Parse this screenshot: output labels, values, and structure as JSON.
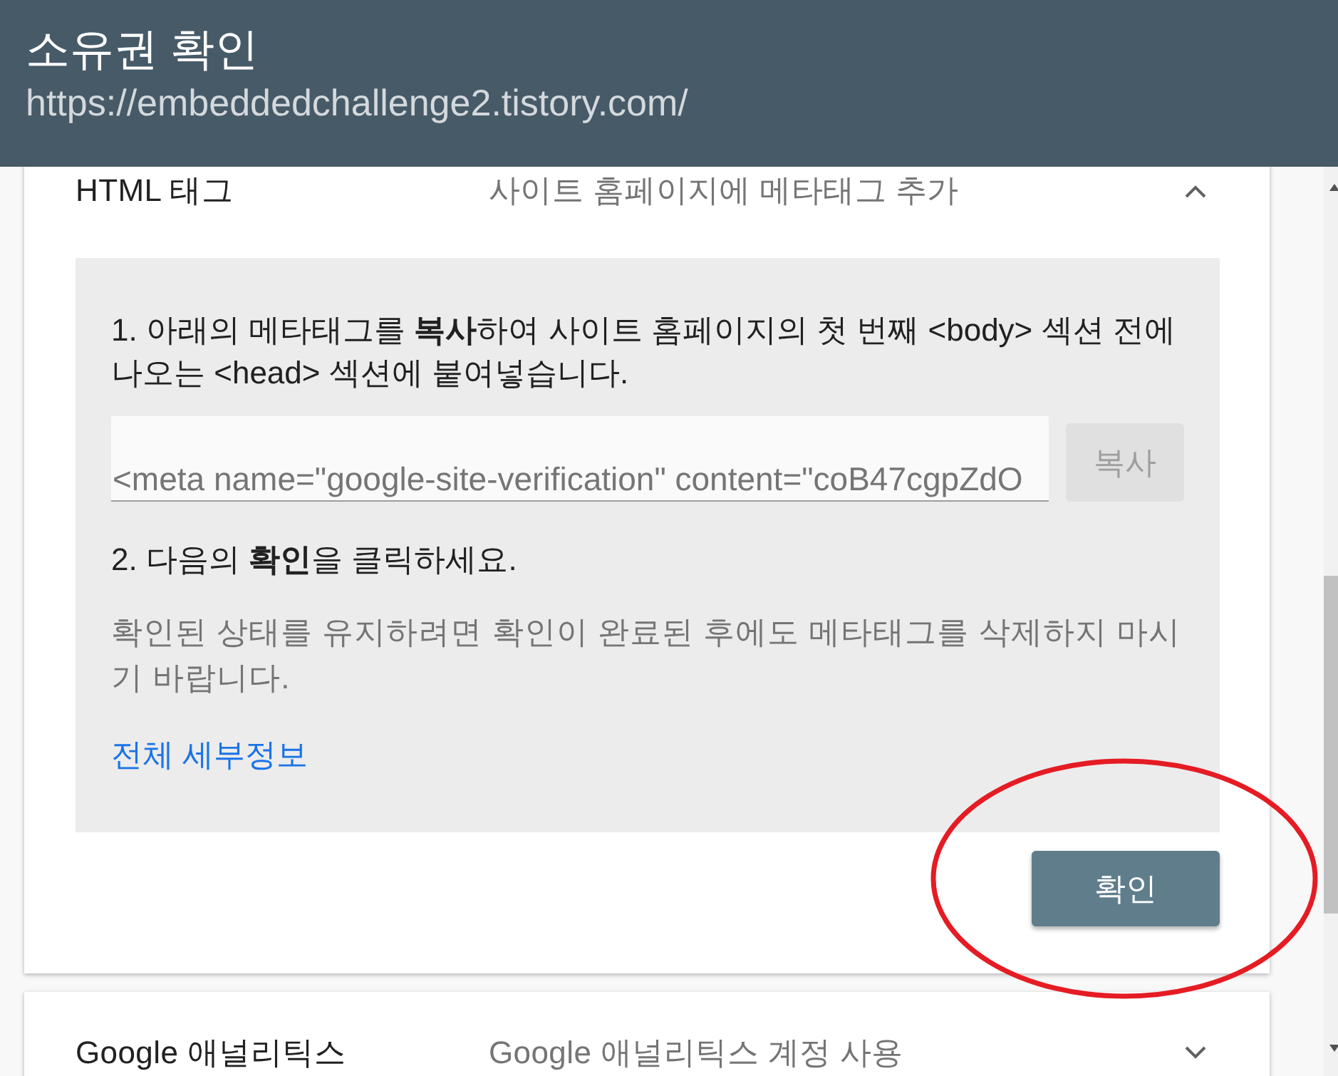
{
  "header": {
    "title": "소유권 확인",
    "url": "https://embeddedchallenge2.tistory.com/"
  },
  "methods": [
    {
      "title": "HTML 태그",
      "summary": "사이트 홈페이지에 메타태그 추가",
      "expanded": true,
      "instructions": {
        "step_1": "1. 아래의 메타태그를 **복사**하여 사이트 홈페이지의 첫 번째 <body> 섹션 전에 나오는 <head> 섹션에 붙여넣습니다.",
        "meta_tag_field": {
          "value": "<meta name=\"google-site-verification\" content=\"coB47cgpZdO"
        },
        "copy_button": "복사",
        "step_2": "2. 다음의 **확인**을 클릭하세요.",
        "note": "확인된 상태를 유지하려면 확인이 완료된 후에도 메타태그를 삭제하지 마시기 바랍니다.",
        "details_link": "전체 세부정보"
      },
      "verify_button": {
        "label": "확인",
        "circled": true
      }
    },
    {
      "title": "Google 애널리틱스",
      "summary": "Google 애널리틱스 계정 사용",
      "expanded": false
    }
  ]
}
